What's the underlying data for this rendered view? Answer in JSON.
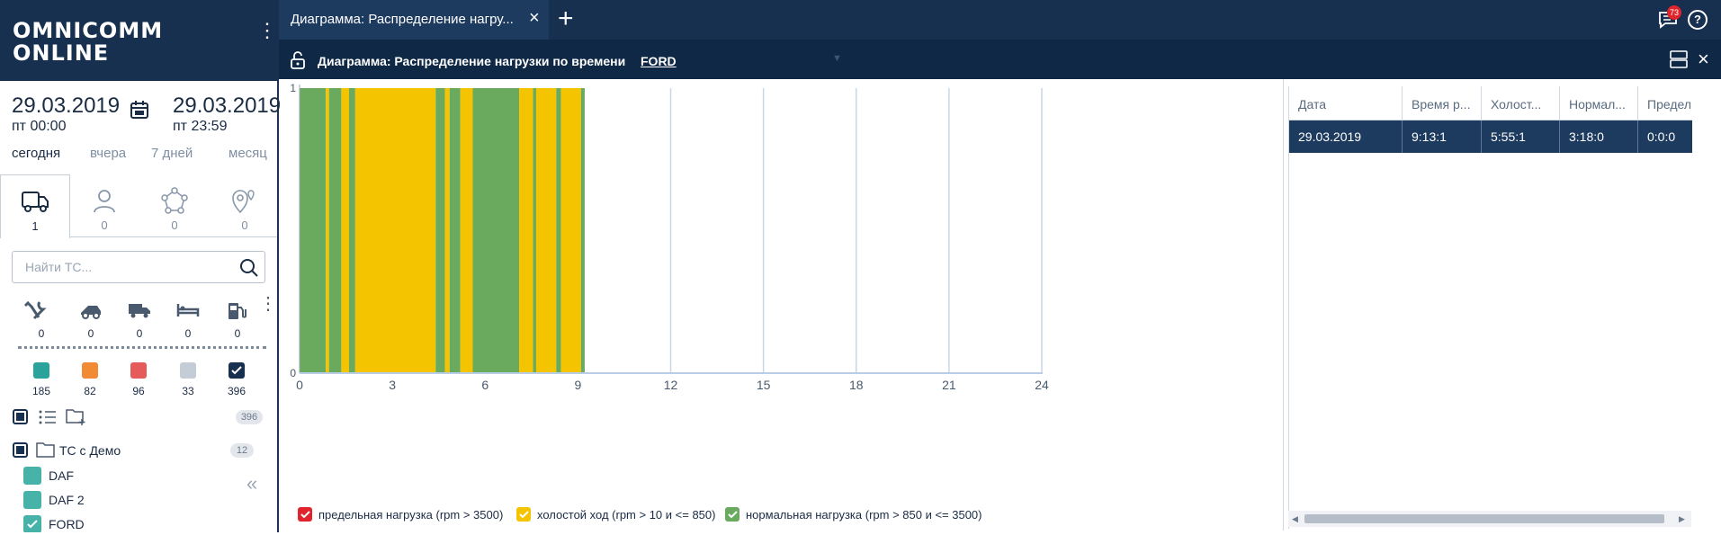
{
  "app": {
    "logo_line1": "OMNICOMM",
    "logo_line2": "ONLINE"
  },
  "tabs": [
    {
      "label": "Диаграмма: Распределение нагру..."
    }
  ],
  "notifications": {
    "count": "73"
  },
  "panel": {
    "title": "Диаграмма: Распределение нагрузки по времени",
    "vehicle": "FORD"
  },
  "date_range": {
    "from_date": "29.03.2019",
    "from_time": "пт 00:00",
    "to_date": "29.03.2019",
    "to_time": "пт 23:59"
  },
  "quick_ranges": [
    "сегодня",
    "вчера",
    "7 дней",
    "месяц"
  ],
  "object_tabs": [
    {
      "icon": "truck-icon",
      "count": "1"
    },
    {
      "icon": "person-icon",
      "count": "0"
    },
    {
      "icon": "network-icon",
      "count": "0"
    },
    {
      "icon": "geofence-icon",
      "count": "0"
    }
  ],
  "search": {
    "placeholder": "Найти ТС..."
  },
  "status_icons": [
    {
      "icon": "service-icon",
      "count": "0"
    },
    {
      "icon": "tow-icon",
      "count": "0"
    },
    {
      "icon": "truck-small-icon",
      "count": "0"
    },
    {
      "icon": "bed-icon",
      "count": "0"
    },
    {
      "icon": "fuel-icon",
      "count": "0"
    }
  ],
  "status_colors": [
    {
      "color": "#2aa39a",
      "count": "185"
    },
    {
      "color": "#f08a33",
      "count": "82"
    },
    {
      "color": "#e55b5b",
      "count": "96"
    },
    {
      "color": "#c4ccd6",
      "count": "33"
    },
    {
      "color": "#17304f",
      "count": "396",
      "checked": true
    }
  ],
  "list_total": "396",
  "tree": {
    "group": {
      "label": "ТС с Демо",
      "count": "12"
    },
    "items": [
      {
        "label": "DAF",
        "checked": false
      },
      {
        "label": "DAF 2",
        "checked": false
      },
      {
        "label": "FORD",
        "checked": true
      }
    ]
  },
  "chart_data": {
    "type": "area",
    "x_ticks": [
      "0",
      "3",
      "6",
      "9",
      "12",
      "15",
      "18",
      "21",
      "24"
    ],
    "y_ticks": [
      "0",
      "1"
    ],
    "xlim": [
      0,
      24
    ],
    "ylim": [
      0,
      1
    ],
    "colors": {
      "yellow": "#f5c400",
      "green": "#6aaa5e",
      "red": "#e0242b"
    },
    "segments": [
      {
        "start": 0.0,
        "end": 0.85,
        "state": "green"
      },
      {
        "start": 0.85,
        "end": 0.95,
        "state": "yellow"
      },
      {
        "start": 0.95,
        "end": 1.35,
        "state": "green"
      },
      {
        "start": 1.35,
        "end": 1.6,
        "state": "yellow"
      },
      {
        "start": 1.6,
        "end": 1.8,
        "state": "green"
      },
      {
        "start": 1.8,
        "end": 4.4,
        "state": "yellow"
      },
      {
        "start": 4.4,
        "end": 4.7,
        "state": "green"
      },
      {
        "start": 4.7,
        "end": 4.85,
        "state": "yellow"
      },
      {
        "start": 4.85,
        "end": 5.2,
        "state": "green"
      },
      {
        "start": 5.2,
        "end": 5.6,
        "state": "yellow"
      },
      {
        "start": 5.6,
        "end": 7.1,
        "state": "green"
      },
      {
        "start": 7.1,
        "end": 7.55,
        "state": "yellow"
      },
      {
        "start": 7.55,
        "end": 7.65,
        "state": "green"
      },
      {
        "start": 7.65,
        "end": 8.3,
        "state": "yellow"
      },
      {
        "start": 8.3,
        "end": 8.45,
        "state": "green"
      },
      {
        "start": 8.45,
        "end": 9.1,
        "state": "yellow"
      },
      {
        "start": 9.1,
        "end": 9.22,
        "state": "green"
      }
    ],
    "legend": [
      {
        "label": "предельная нагрузка (rpm > 3500)",
        "color": "#e0242b"
      },
      {
        "label": "холостой ход (rpm > 10 и <= 850)",
        "color": "#f5c400"
      },
      {
        "label": "нормальная нагрузка (rpm > 850 и <= 3500)",
        "color": "#6aaa5e"
      }
    ]
  },
  "table": {
    "headers": [
      "Дата",
      "Время р...",
      "Холост...",
      "Нормал...",
      "Предел"
    ],
    "rows": [
      [
        "29.03.2019",
        "9:13:1",
        "5:55:1",
        "3:18:0",
        "0:0:0"
      ]
    ]
  }
}
